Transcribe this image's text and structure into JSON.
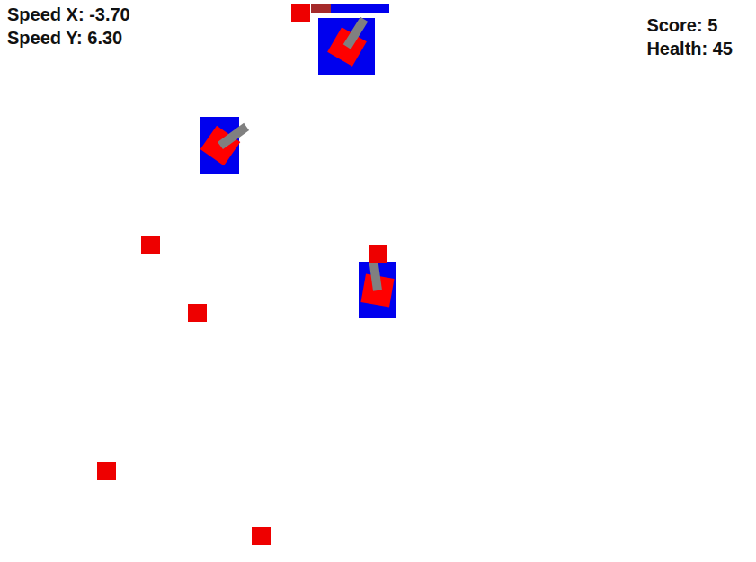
{
  "hud": {
    "speed_x": "Speed X: -3.70",
    "speed_y": "Speed Y: 6.30",
    "score": "Score: 5",
    "health": "Health: 45"
  },
  "tanks": [
    {
      "kind": "enemy",
      "turret_rotation": 30,
      "barrel_angle": -58,
      "health_bar": {
        "visible": true,
        "level": 0.25
      }
    },
    {
      "kind": "enemy",
      "turret_rotation": 35,
      "barrel_angle": -36,
      "health_bar": {
        "visible": false,
        "level": 1
      }
    },
    {
      "kind": "enemy",
      "turret_rotation": 10,
      "barrel_angle": -98,
      "health_bar": {
        "visible": false,
        "level": 1
      }
    }
  ],
  "bullets": [
    {
      "kind": "bullet"
    },
    {
      "kind": "bullet"
    },
    {
      "kind": "bullet"
    },
    {
      "kind": "bullet"
    },
    {
      "kind": "bullet"
    },
    {
      "kind": "bullet"
    }
  ]
}
